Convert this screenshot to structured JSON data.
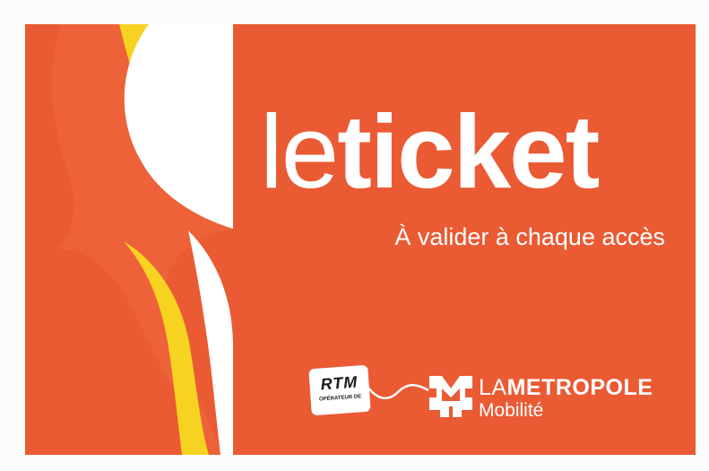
{
  "card": {
    "brand_prefix": "le",
    "brand_word": "ticket",
    "subtitle": "À valider à chaque accès",
    "background_color": "#ea5a33",
    "accent_yellow": "#f6d321",
    "text_color": "#ffffff"
  },
  "operator": {
    "name": "RTM",
    "caption": "OPÉRATEUR DE"
  },
  "authority": {
    "name_prefix": "LA",
    "name_main": "METROPOLE",
    "subtitle": "Mobilité",
    "logo_icon": "metropole-mobilite-logo-icon"
  }
}
